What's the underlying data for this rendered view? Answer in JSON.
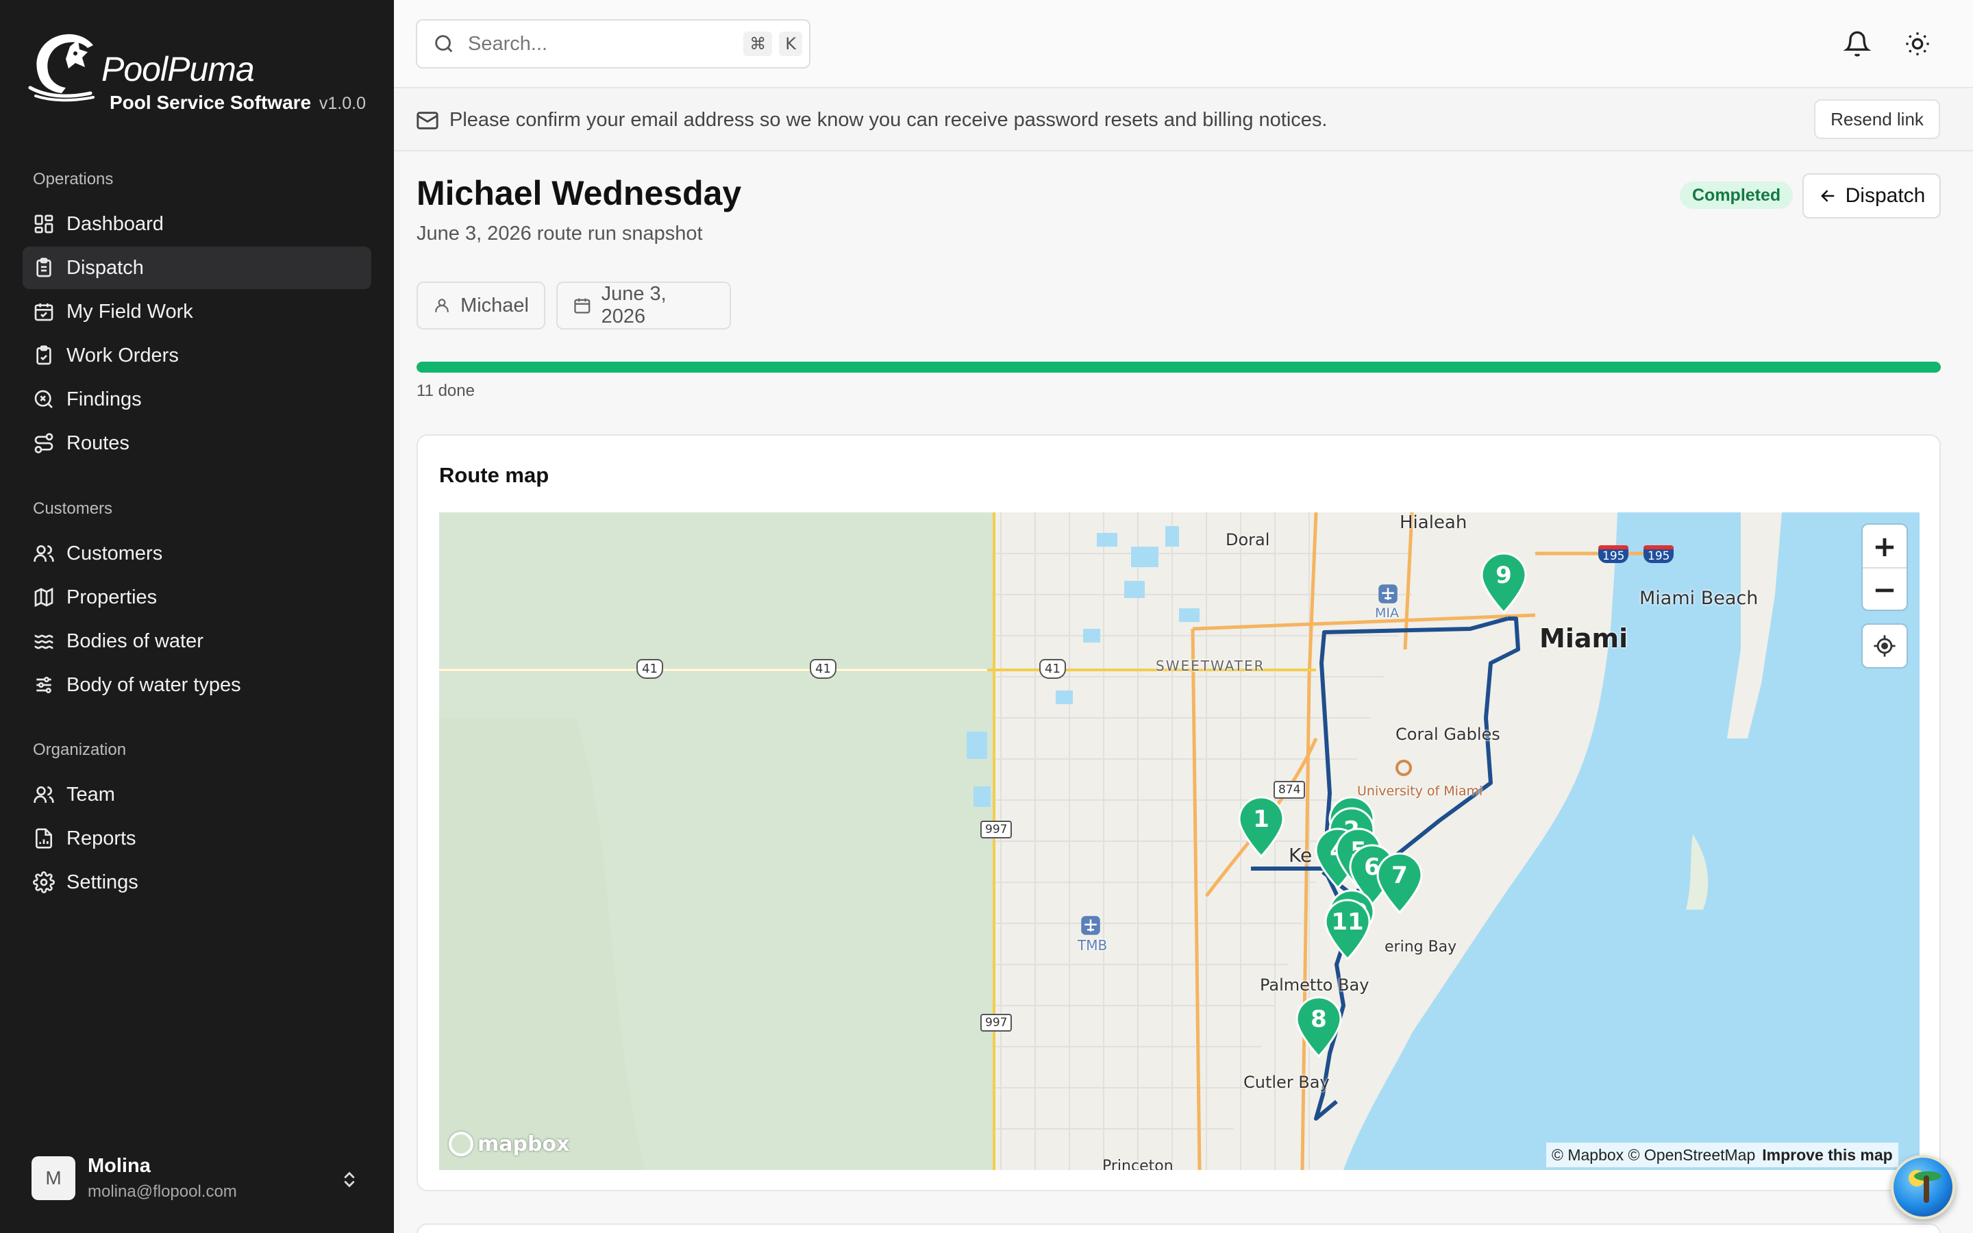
{
  "brand": {
    "name": "PoolPuma",
    "subtitle": "Pool Service Software",
    "version": "v1.0.0"
  },
  "sidebar": {
    "sections": [
      {
        "title": "Operations",
        "items": [
          {
            "label": "Dashboard",
            "icon": "dashboard-icon"
          },
          {
            "label": "Dispatch",
            "icon": "clipboard-icon",
            "active": true
          },
          {
            "label": "My Field Work",
            "icon": "calendar-check-icon"
          },
          {
            "label": "Work Orders",
            "icon": "clipboard-check-icon"
          },
          {
            "label": "Findings",
            "icon": "search-x-icon"
          },
          {
            "label": "Routes",
            "icon": "route-icon"
          }
        ]
      },
      {
        "title": "Customers",
        "items": [
          {
            "label": "Customers",
            "icon": "users-icon"
          },
          {
            "label": "Properties",
            "icon": "map-icon"
          },
          {
            "label": "Bodies of water",
            "icon": "waves-icon"
          },
          {
            "label": "Body of water types",
            "icon": "sliders-icon"
          }
        ]
      },
      {
        "title": "Organization",
        "items": [
          {
            "label": "Team",
            "icon": "users-icon"
          },
          {
            "label": "Reports",
            "icon": "report-icon"
          },
          {
            "label": "Settings",
            "icon": "gear-icon"
          }
        ]
      }
    ],
    "user": {
      "initial": "M",
      "name": "Molina",
      "email": "molina@flopool.com"
    }
  },
  "topbar": {
    "search_placeholder": "Search...",
    "shortcut_keys": [
      "⌘",
      "K"
    ]
  },
  "banner": {
    "text": "Please confirm your email address so we know you can receive password resets and billing notices.",
    "action": "Resend link"
  },
  "page": {
    "title": "Michael Wednesday",
    "subtitle": "June 3, 2026 route run snapshot",
    "status": "Completed",
    "back_label": "Dispatch",
    "technician": "Michael",
    "date": "June 3, 2026",
    "progress_fraction": 1.0,
    "progress_label": "11 done"
  },
  "route_map": {
    "title": "Route map",
    "labels": {
      "hialeah": "Hialeah",
      "doral": "Doral",
      "mia": "MIA",
      "miami": "Miami",
      "miami_beach": "Miami Beach",
      "sweetwater": "SWEETWATER",
      "coral_gables": "Coral Gables",
      "univ_miami": "University of Miami",
      "kendall": "Ke",
      "tmb": "TMB",
      "pinecrest_bay": "ering Bay",
      "palmetto_bay": "Palmetto Bay",
      "cutler_bay": "Cutler Bay",
      "princeton": "Princeton"
    },
    "shields": {
      "us41_a": "41",
      "us41_b": "41",
      "us41_c": "41",
      "sr874": "874",
      "sr997_a": "997",
      "sr997_b": "997",
      "i195_a": "195",
      "i195_b": "195"
    },
    "stops": [
      "1",
      "2",
      "4",
      "5",
      "6",
      "7",
      "3",
      "10",
      "11",
      "8",
      "9"
    ],
    "zoom_in": "+",
    "zoom_out": "−",
    "mapbox_logo": "mapbox",
    "attribution": "© Mapbox © OpenStreetMap",
    "improve": "Improve this map",
    "colors": {
      "route": "#1f4e8c",
      "marker": "#1fb477",
      "water": "#a8dcf5",
      "everglades": "#d9e8d4"
    }
  }
}
